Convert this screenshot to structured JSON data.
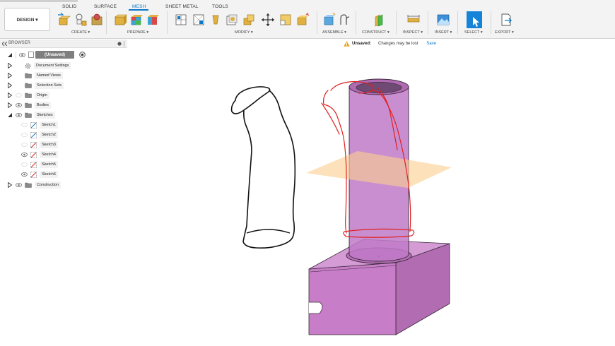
{
  "workspace_button": "DESIGN ▾",
  "tabs": [
    {
      "label": "SOLID"
    },
    {
      "label": "SURFACE"
    },
    {
      "label": "MESH"
    },
    {
      "label": "SHEET METAL"
    },
    {
      "label": "TOOLS"
    }
  ],
  "groups": {
    "create": "CREATE ▾",
    "prepare": "PREPARE ▾",
    "modify": "MODIFY ▾",
    "assemble": "ASSEMBLE ▾",
    "construct": "CONSTRUCT ▾",
    "inspect": "INSPECT ▾",
    "insert": "INSERT ▾",
    "select": "SELECT ▾",
    "export": "EXPORT ▾"
  },
  "browser": {
    "title": "BROWSER",
    "root": "(Unsaved)",
    "items": [
      {
        "label": "Document Settings"
      },
      {
        "label": "Named Views"
      },
      {
        "label": "Selection Sets"
      },
      {
        "label": "Origin"
      },
      {
        "label": "Bodies"
      },
      {
        "label": "Sketches"
      },
      {
        "label": "Sketch1"
      },
      {
        "label": "Sketch2"
      },
      {
        "label": "Sketch3"
      },
      {
        "label": "Sketch4"
      },
      {
        "label": "Sketch5"
      },
      {
        "label": "Sketch6"
      },
      {
        "label": "Construction"
      }
    ]
  },
  "status": {
    "unsaved_label": "Unsaved:",
    "message": "Changes may be lost",
    "save": "Save"
  },
  "colors": {
    "accent": "#0a78c8",
    "body_fill": "#c880c8",
    "plane_fill": "#fbcf8f",
    "sketch_red": "#e02020"
  }
}
